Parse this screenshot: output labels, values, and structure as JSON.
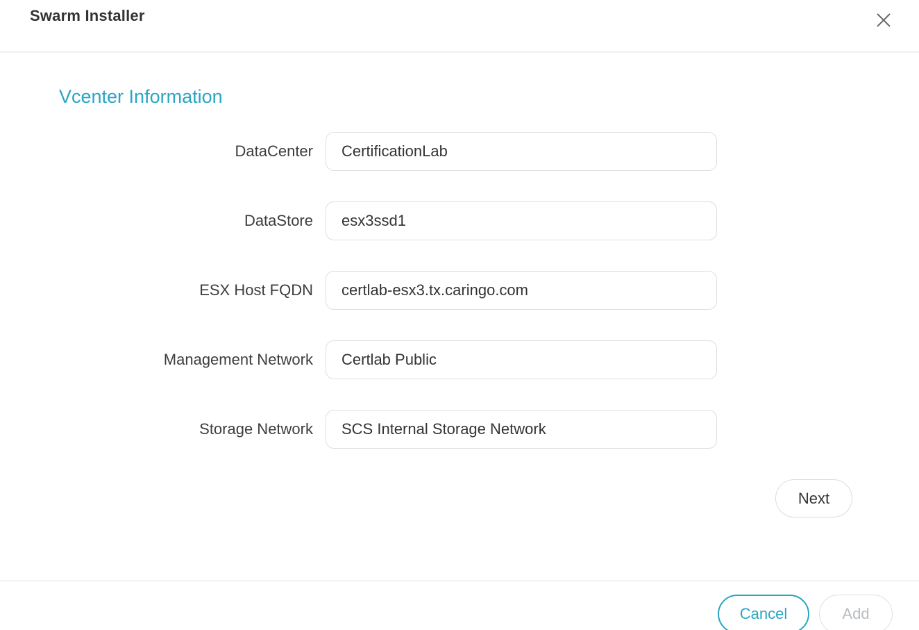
{
  "dialog": {
    "title": "Swarm Installer",
    "close_icon": "close-icon"
  },
  "section": {
    "title": "Vcenter Information"
  },
  "form": {
    "fields": [
      {
        "label": "DataCenter",
        "value": "CertificationLab"
      },
      {
        "label": "DataStore",
        "value": "esx3ssd1"
      },
      {
        "label": "ESX Host FQDN",
        "value": "certlab-esx3.tx.caringo.com"
      },
      {
        "label": "Management Network",
        "value": "Certlab Public"
      },
      {
        "label": "Storage Network",
        "value": "SCS Internal Storage Network"
      }
    ],
    "next_label": "Next"
  },
  "footer": {
    "cancel_label": "Cancel",
    "add_label": "Add"
  },
  "colors": {
    "accent": "#2aa5c3",
    "disabled_text": "#b9bdc1"
  }
}
